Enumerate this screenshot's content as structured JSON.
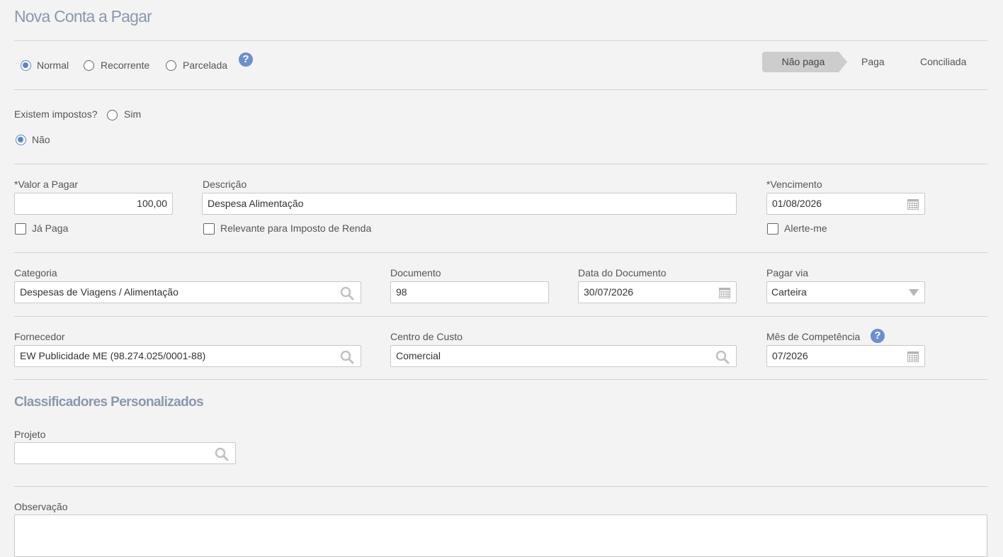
{
  "page": {
    "title": "Nova Conta a Pagar"
  },
  "type_options": {
    "normal": "Normal",
    "recorrente": "Recorrente",
    "parcelada": "Parcelada",
    "selected": "Normal",
    "help": "?"
  },
  "status_steps": {
    "nao_paga": "Não paga",
    "paga": "Paga",
    "conciliada": "Conciliada",
    "active": "Não paga"
  },
  "taxes": {
    "question": "Existem impostos?",
    "sim": "Sim",
    "nao": "Não",
    "selected": "Não"
  },
  "valor": {
    "label": "*Valor a Pagar",
    "value": "100,00",
    "ja_paga": "Já Paga",
    "ja_paga_checked": false
  },
  "descricao": {
    "label": "Descrição",
    "value": "Despesa Alimentação",
    "relevante": "Relevante para Imposto de Renda",
    "relevante_checked": false
  },
  "vencimento": {
    "label": "*Vencimento",
    "value": "01/08/2026",
    "alerte": "Alerte-me",
    "alerte_checked": false
  },
  "categoria": {
    "label": "Categoria",
    "value": "Despesas de Viagens / Alimentação"
  },
  "documento": {
    "label": "Documento",
    "value": "98"
  },
  "data_documento": {
    "label": "Data do Documento",
    "value": "30/07/2026"
  },
  "pagar_via": {
    "label": "Pagar via",
    "value": "Carteira"
  },
  "fornecedor": {
    "label": "Fornecedor",
    "value": "EW Publicidade ME (98.274.025/0001-88)"
  },
  "centro_custo": {
    "label": "Centro de Custo",
    "value": "Comercial"
  },
  "competencia": {
    "label": "Mês de Competência",
    "value": "07/2026",
    "help": "?"
  },
  "classificadores": {
    "title": "Classificadores Personalizados",
    "projeto_label": "Projeto",
    "projeto_value": ""
  },
  "observacao": {
    "label": "Observação",
    "value": ""
  },
  "colors": {
    "accent": "#5a86c8",
    "title": "#8a98ad",
    "help": "#6b8fcf"
  }
}
